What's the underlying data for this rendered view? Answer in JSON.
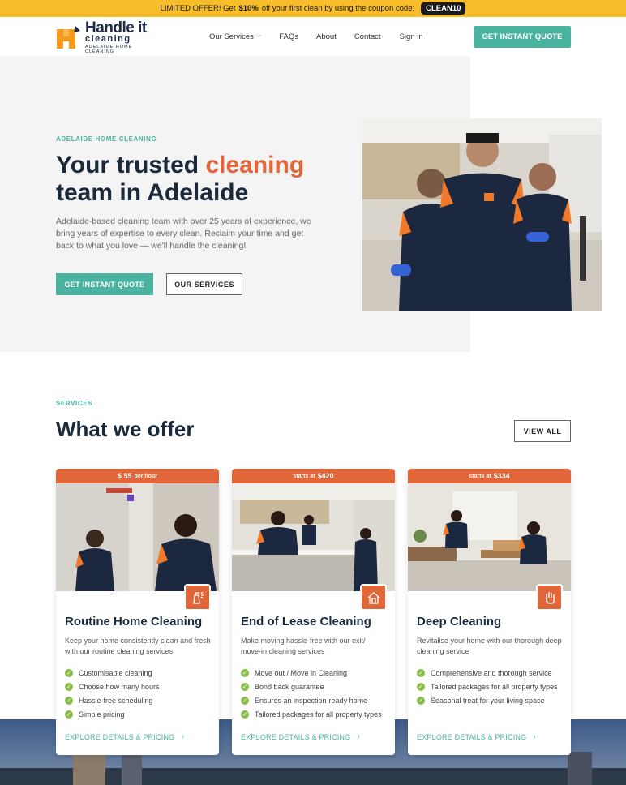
{
  "promo": {
    "prefix": "LIMITED OFFER! Get",
    "amount": "$10%",
    "suffix": "off your first clean by using the coupon code:",
    "code": "CLEAN10"
  },
  "logo": {
    "line1": "Handle it",
    "line2": "cleaning",
    "tagline": "ADELAIDE HOME CLEANING"
  },
  "nav": {
    "items": [
      "Our Services",
      "FAQs",
      "About",
      "Contact",
      "Sign in"
    ],
    "cta": "GET INSTANT QUOTE"
  },
  "hero": {
    "eyebrow": "ADELAIDE HOME CLEANING",
    "title_part1": "Your trusted ",
    "title_accent": "cleaning",
    "title_part2": "team in Adelaide",
    "description": "Adelaide-based cleaning team with over 25 years of experience, we bring years of expertise to every clean. Reclaim your time and get back to what you love — we'll handle the cleaning!",
    "primary_button": "GET INSTANT QUOTE",
    "secondary_button": "OUR SERVICES"
  },
  "services": {
    "eyebrow": "SERVICES",
    "title": "What we offer",
    "view_all": "VIEW ALL",
    "cards": [
      {
        "price_prefix": "$ 55",
        "price_suffix": "per hour",
        "title": "Routine Home Cleaning",
        "description": "Keep your home consistently clean and fresh with our routine cleaning services",
        "features": [
          "Customisable cleaning",
          "Choose how many hours",
          "Hassle-free scheduling",
          "Simple pricing"
        ],
        "link": "EXPLORE DETAILS & PRICING",
        "icon": "cleaning-spray-icon"
      },
      {
        "price_prefix": "starts at",
        "price_suffix": "$420",
        "title": "End of Lease Cleaning",
        "description": "Make moving hassle-free with our exit/ move-in cleaning services",
        "features": [
          "Move out / Move in Cleaning",
          "Bond back guarantee",
          "Ensures an inspection-ready home",
          "Tailored packages for all property types"
        ],
        "link": "EXPLORE DETAILS & PRICING",
        "icon": "house-icon"
      },
      {
        "price_prefix": "starts at",
        "price_suffix": "$334",
        "title": "Deep Cleaning",
        "description": "Revitalise your home with our thorough deep cleaning service",
        "features": [
          "Comprehensive and thorough service",
          "Tailored packages for all property types",
          "Seasonal treat for your living space"
        ],
        "link": "EXPLORE DETAILS & PRICING",
        "icon": "glove-icon"
      }
    ]
  },
  "colors": {
    "accent_orange": "#e1663a",
    "teal": "#4ab3a0",
    "promo_yellow": "#f8bd2b",
    "navy": "#1b2a3a",
    "check_green": "#8bbd4a"
  }
}
